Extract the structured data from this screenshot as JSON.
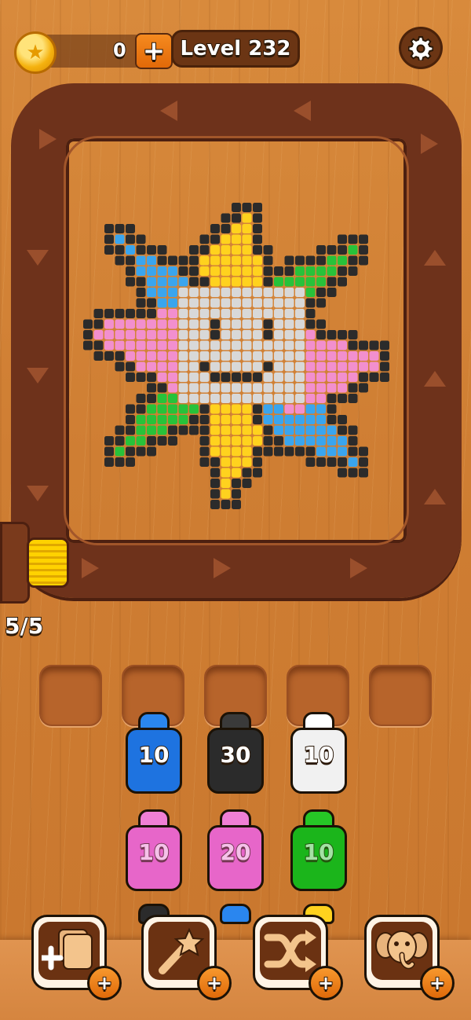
{
  "header": {
    "coin_icon": "star-coin-icon",
    "coins": "0",
    "add_coins_label": "+",
    "level_label": "Level 232",
    "settings_icon": "gear-icon"
  },
  "feeder": {
    "count": "5/5",
    "spool_color": "#ffd200"
  },
  "slots": {
    "empty_count": 5
  },
  "bottles": [
    {
      "label": "10",
      "color": "#1e73e0",
      "cap": "#2a86ef"
    },
    {
      "label": "30",
      "color": "#2b2b2b",
      "cap": "#3a3a3a"
    },
    {
      "label": "10",
      "color": "#f1f1f1",
      "cap": "#ffffff"
    },
    {
      "label": "10",
      "color": "#e766c9",
      "cap": "#f07fd6"
    },
    {
      "label": "20",
      "color": "#e766c9",
      "cap": "#f07fd6"
    },
    {
      "label": "10",
      "color": "#1bb51b",
      "cap": "#26c726"
    }
  ],
  "powerups": [
    {
      "name": "add-slot",
      "icon": "add-slot-icon",
      "plus": "+"
    },
    {
      "name": "magic-wand",
      "icon": "magic-wand-icon",
      "plus": "+"
    },
    {
      "name": "shuffle",
      "icon": "shuffle-icon",
      "plus": "+"
    },
    {
      "name": "elephant",
      "icon": "elephant-icon",
      "plus": "+"
    }
  ],
  "colors": {
    "wood": "#d88a3c",
    "belt": "#6e321b",
    "pixel_outline": "#2b2b2b",
    "pixel_yellow": "#ffd21e",
    "pixel_blue": "#3aa5ee",
    "pixel_green": "#27c23a",
    "pixel_pink": "#f28fce",
    "pixel_gray": "#d8d8d8"
  }
}
